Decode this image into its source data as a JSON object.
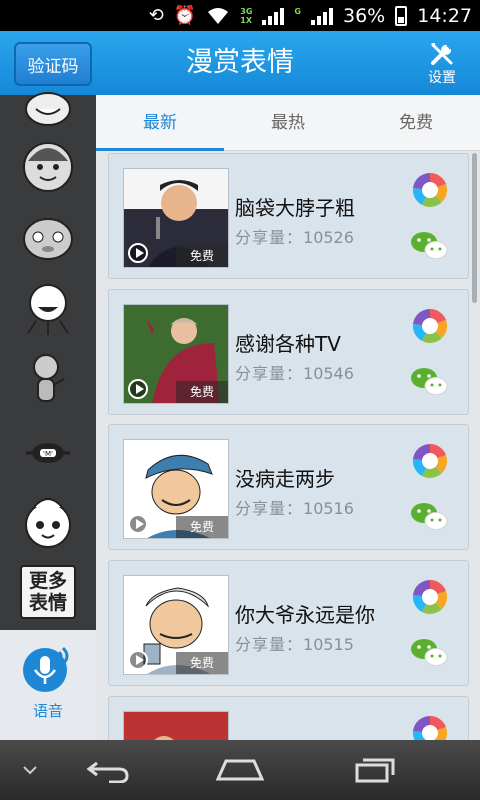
{
  "status_bar": {
    "net_top": "3G",
    "net_bottom": "1X",
    "net_g": "G",
    "battery": "36%",
    "time": "14:27"
  },
  "header": {
    "verify_button": "验证码",
    "title": "漫赏表情",
    "settings_label": "设置"
  },
  "sidebar": {
    "more_label_line1": "更多",
    "more_label_line2": "表情",
    "voice_label": "语音"
  },
  "tabs": [
    {
      "label": "最新",
      "active": true
    },
    {
      "label": "最热",
      "active": false
    },
    {
      "label": "免费",
      "active": false
    }
  ],
  "share_label": "分享量：",
  "free_label": "免费",
  "items": [
    {
      "title": "脑袋大脖子粗",
      "share_count": "10526"
    },
    {
      "title": "感谢各种TV",
      "share_count": "10546"
    },
    {
      "title": "没病走两步",
      "share_count": "10516"
    },
    {
      "title": "你大爷永远是你",
      "share_count": "10515"
    },
    {
      "title": "",
      "share_count": ""
    }
  ],
  "colors": {
    "header": "#1e8fde",
    "accent": "#1e88d6",
    "sidebar": "#3a3b3d",
    "card": "#d9e3ec"
  }
}
